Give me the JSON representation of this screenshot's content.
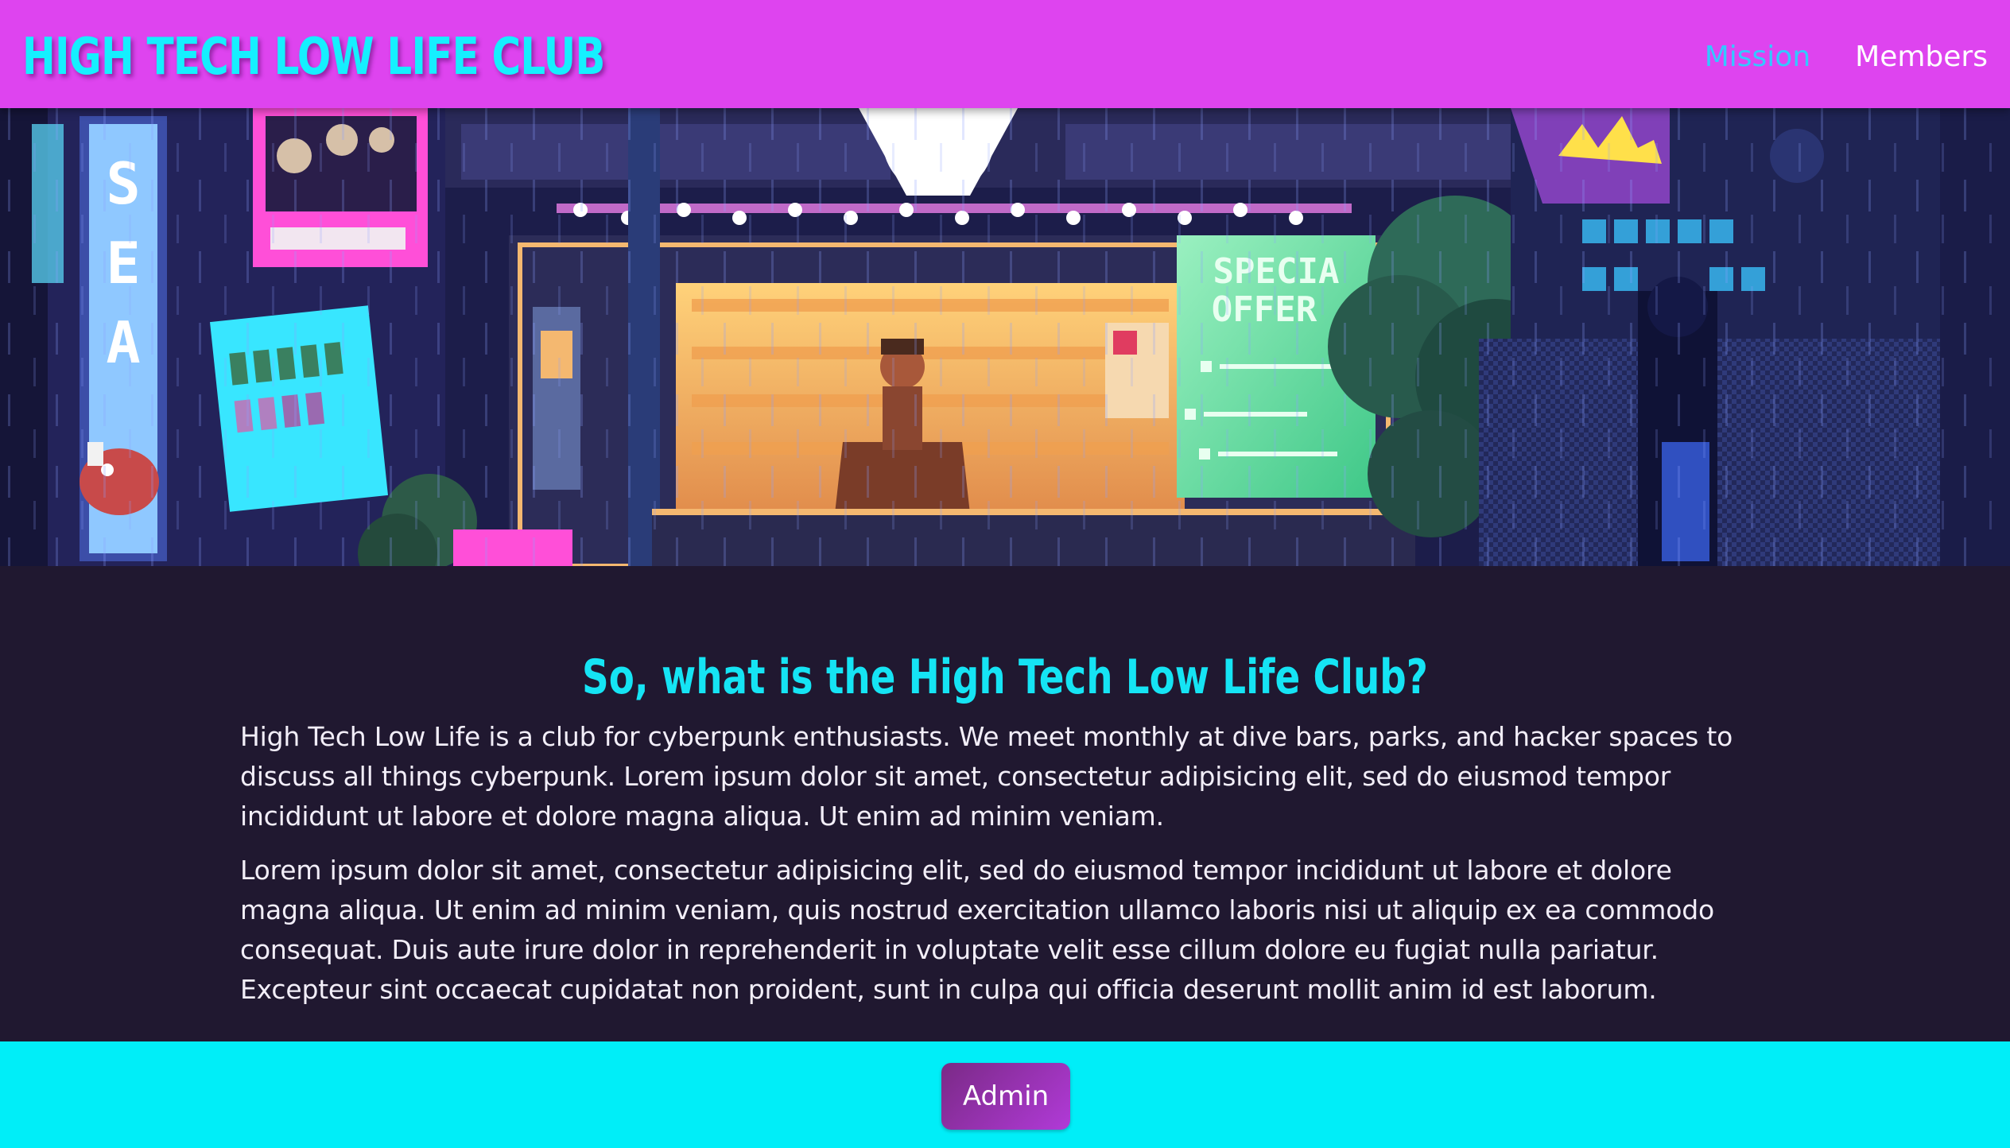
{
  "header": {
    "title": "HIGH TECH LOW LIFE CLUB",
    "nav": [
      {
        "label": "Mission",
        "active": true
      },
      {
        "label": "Members",
        "active": false
      }
    ]
  },
  "hero": {
    "sign_text": "SPECIAL OFFER",
    "colors": {
      "sky": "#1a1a44",
      "neon_pink": "#ff4fd8",
      "neon_cyan": "#38e6ff",
      "shop_glow": "#f4a860",
      "sign_green": "#5fe0a0"
    }
  },
  "main": {
    "heading": "So, what is the High Tech Low Life Club?",
    "paragraphs": [
      "High Tech Low Life is a club for cyberpunk enthusiasts. We meet monthly at dive bars, parks, and hacker spaces to discuss all things cyberpunk. Lorem ipsum dolor sit amet, consectetur adipisicing elit, sed do eiusmod tempor incididunt ut labore et dolore magna aliqua. Ut enim ad minim veniam.",
      "Lorem ipsum dolor sit amet, consectetur adipisicing elit, sed do eiusmod tempor incididunt ut labore et dolore magna aliqua. Ut enim ad minim veniam, quis nostrud exercitation ullamco laboris nisi ut aliquip ex ea commodo consequat. Duis aute irure dolor in reprehenderit in voluptate velit esse cillum dolore eu fugiat nulla pariatur. Excepteur sint occaecat cupidatat non proident, sunt in culpa qui officia deserunt mollit anim id est laborum."
    ]
  },
  "footer": {
    "admin_label": "Admin"
  },
  "colors": {
    "header_bg": "#de44ef",
    "title": "#15f0ff",
    "nav_active": "#33c8ff",
    "main_bg": "#201830",
    "heading": "#15e4f4",
    "footer_bg": "#00eef8",
    "button": "#9a32b4"
  }
}
